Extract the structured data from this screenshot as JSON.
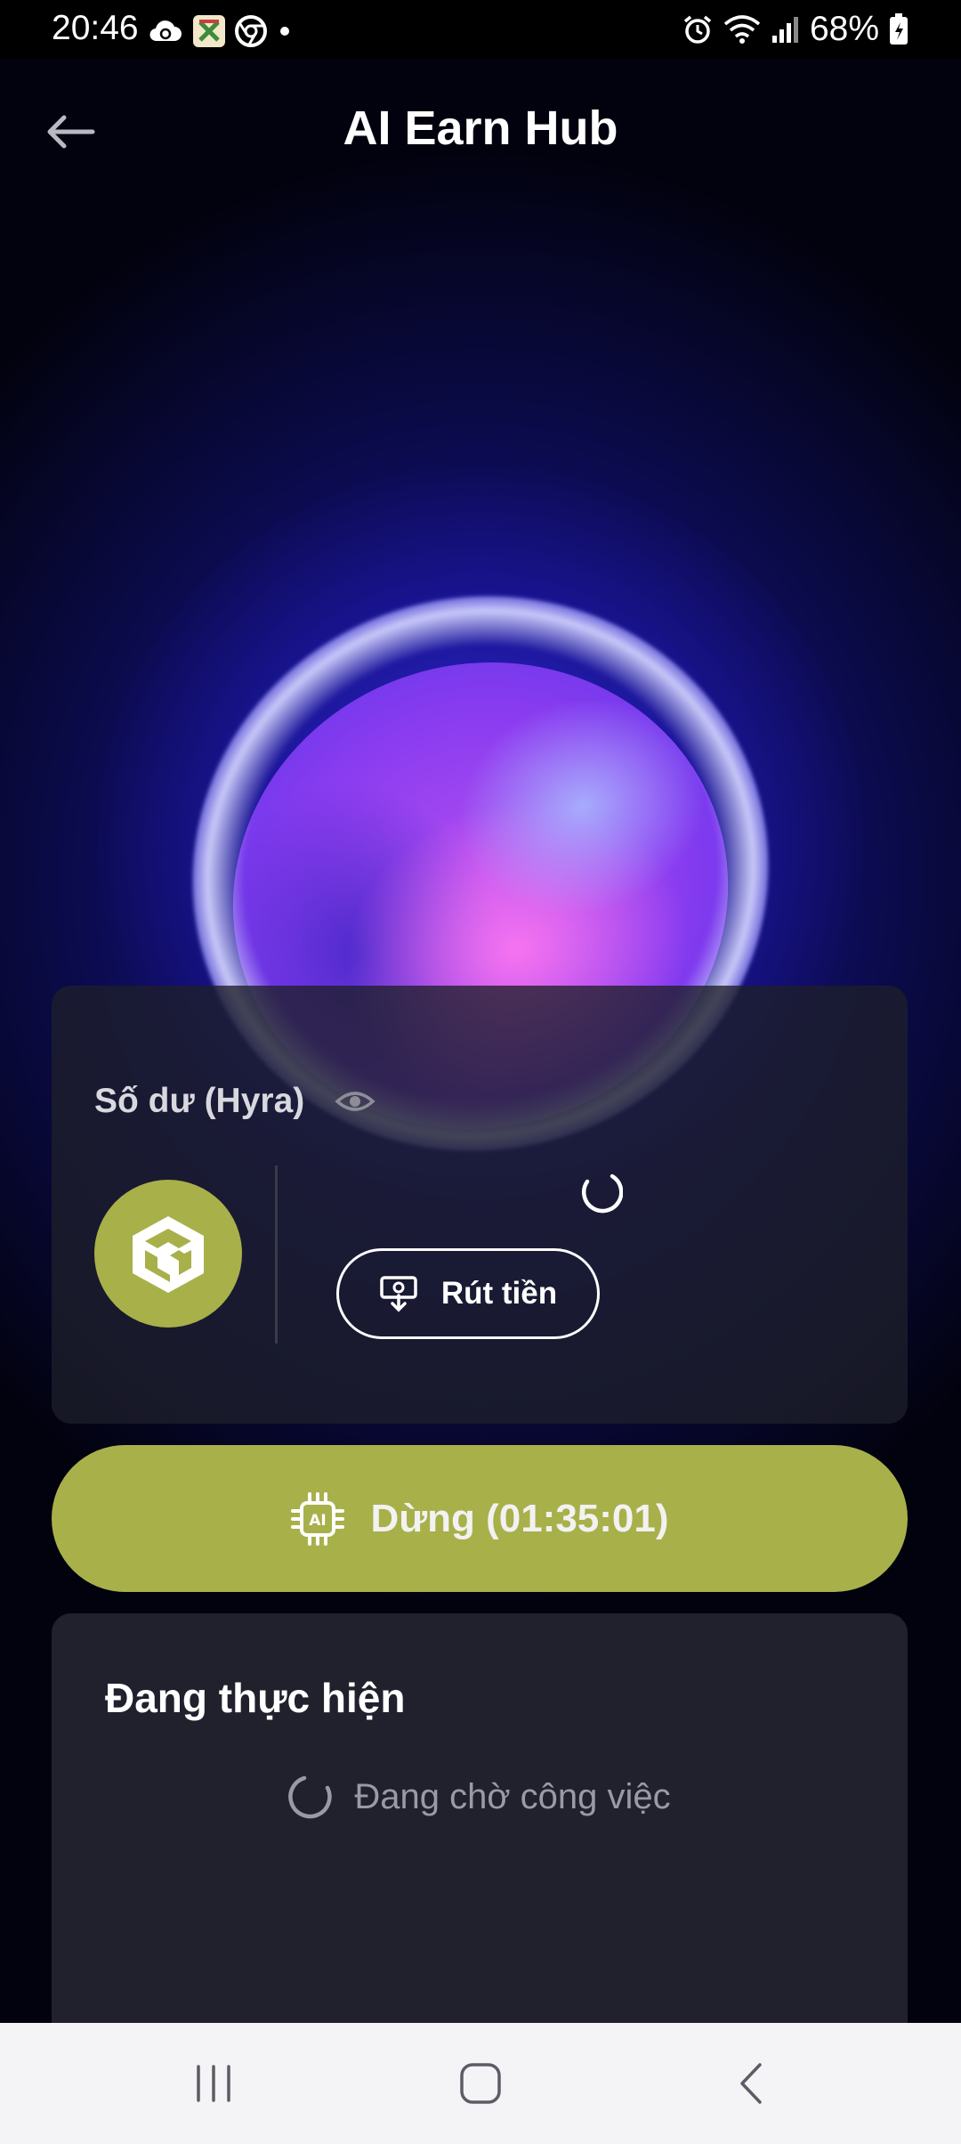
{
  "status_bar": {
    "time": "20:46",
    "battery": "68%",
    "left_icons": [
      "cloud-sync-icon",
      "app-x-icon",
      "chrome-icon",
      "dot-icon"
    ],
    "right_icons": [
      "alarm-icon",
      "wifi-icon",
      "signal-icon",
      "battery-icon"
    ]
  },
  "header": {
    "title": "AI Earn Hub",
    "back_icon": "arrow-left-icon"
  },
  "balance_card": {
    "label": "Số dư (Hyra)",
    "eye_icon": "eye-icon",
    "token_icon": "hyra-cube-icon",
    "loading_icon": "spinner-icon",
    "withdraw_label": "Rút tiền",
    "withdraw_icon": "withdraw-money-icon"
  },
  "stop_button": {
    "label": "Dừng (01:35:01)",
    "icon": "ai-chip-icon"
  },
  "progress_card": {
    "title": "Đang thực hiện",
    "waiting_text": "Đang chờ công việc",
    "waiting_icon": "spinner-icon"
  },
  "nav_bar": {
    "items": [
      "recent-apps-icon",
      "home-icon",
      "back-icon"
    ]
  },
  "colors": {
    "accent": "#a8b04a",
    "card": "#20212d",
    "background": "#0a0a44"
  }
}
